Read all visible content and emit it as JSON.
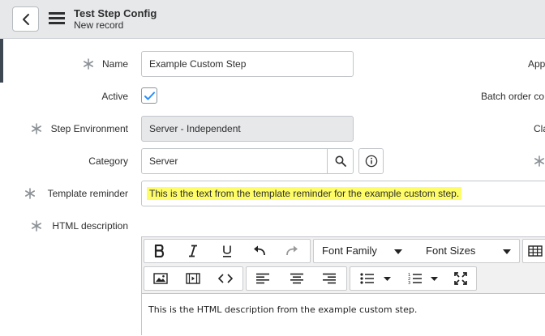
{
  "header": {
    "title": "Test Step Config",
    "subtitle": "New record"
  },
  "fields": {
    "name": {
      "label": "Name",
      "value": "Example Custom Step"
    },
    "active": {
      "label": "Active",
      "checked": true
    },
    "step_environment": {
      "label": "Step Environment",
      "value": "Server - Independent"
    },
    "category": {
      "label": "Category",
      "value": "Server"
    },
    "template_reminder": {
      "label": "Template reminder",
      "value": "This is the text from the template reminder for the example custom step."
    },
    "html_description": {
      "label": "HTML description",
      "value": "This is the HTML description from the example custom step."
    }
  },
  "right_column": {
    "application_label": "App",
    "batch_order_label": "Batch order co",
    "class_label": "Cla"
  },
  "editor_toolbar": {
    "font_family": "Font Family",
    "font_sizes": "Font Sizes",
    "buttons_row1": [
      "bold-icon",
      "italic-icon",
      "underline-icon",
      "undo-icon",
      "redo-icon",
      "table-icon"
    ],
    "buttons_row2": [
      "image-icon",
      "video-icon",
      "code-icon",
      "align-left-icon",
      "align-center-icon",
      "align-right-icon",
      "bullet-list-icon",
      "numbered-list-icon",
      "fullscreen-icon"
    ]
  },
  "colors": {
    "header_bg": "#e6e8ea",
    "highlight": "#fffd67",
    "checkbox_check": "#278efc",
    "readonly_bg": "#e6e8ea"
  }
}
